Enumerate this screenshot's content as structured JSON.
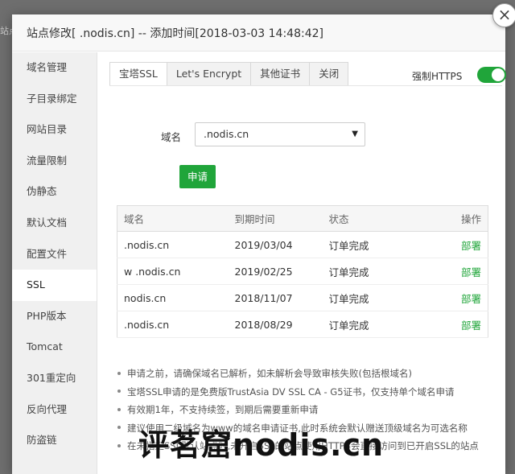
{
  "background": {
    "edge_text": "站点"
  },
  "modal": {
    "title": "站点修改[    .nodis.cn] -- 添加时间[2018-03-03 14:48:42]",
    "close_glyph": "×"
  },
  "sidebar": {
    "items": [
      {
        "label": "域名管理"
      },
      {
        "label": "子目录绑定"
      },
      {
        "label": "网站目录"
      },
      {
        "label": "流量限制"
      },
      {
        "label": "伪静态"
      },
      {
        "label": "默认文档"
      },
      {
        "label": "配置文件"
      },
      {
        "label": "SSL"
      },
      {
        "label": "PHP版本"
      },
      {
        "label": "Tomcat"
      },
      {
        "label": "301重定向"
      },
      {
        "label": "反向代理"
      },
      {
        "label": "防盗链"
      }
    ]
  },
  "tabs": [
    {
      "label": "宝塔SSL"
    },
    {
      "label": "Let's Encrypt"
    },
    {
      "label": "其他证书"
    },
    {
      "label": "关闭"
    }
  ],
  "https": {
    "label": "强制HTTPS",
    "enabled": true
  },
  "form": {
    "domain_label": "域名",
    "domain_value": "    .nodis.cn",
    "apply_label": "申请"
  },
  "table": {
    "headers": {
      "domain": "域名",
      "expire": "到期时间",
      "status": "状态",
      "ops": "操作"
    },
    "rows": [
      {
        "domain": "  .nodis.cn",
        "expire": "2019/03/04",
        "status": "订单完成",
        "op": "部署"
      },
      {
        "domain": "w    .nodis.cn",
        "expire": "2019/02/25",
        "status": "订单完成",
        "op": "部署"
      },
      {
        "domain": "nodis.cn",
        "expire": "2018/11/07",
        "status": "订单完成",
        "op": "部署"
      },
      {
        "domain": "    .nodis.cn",
        "expire": "2018/08/29",
        "status": "订单完成",
        "op": "部署"
      }
    ]
  },
  "notes": [
    "申请之前，请确保域名已解析，如未解析会导致审核失败(包括根域名)",
    "宝塔SSL申请的是免费版TrustAsia DV SSL CA - G5证书，仅支持单个域名申请",
    "有效期1年，不支持续签，到期后需要重新申请",
    "建议使用二级域名为www的域名申请证书,此时系统会默认赠送顶级域名为可选名称",
    "在未指定SSL默认站点时,未开启SSL的站点使用HTTPS会直接访问到已开启SSL的站点"
  ],
  "watermark": "评茗窟nodis.cn",
  "colors": {
    "accent": "#20a53a"
  }
}
